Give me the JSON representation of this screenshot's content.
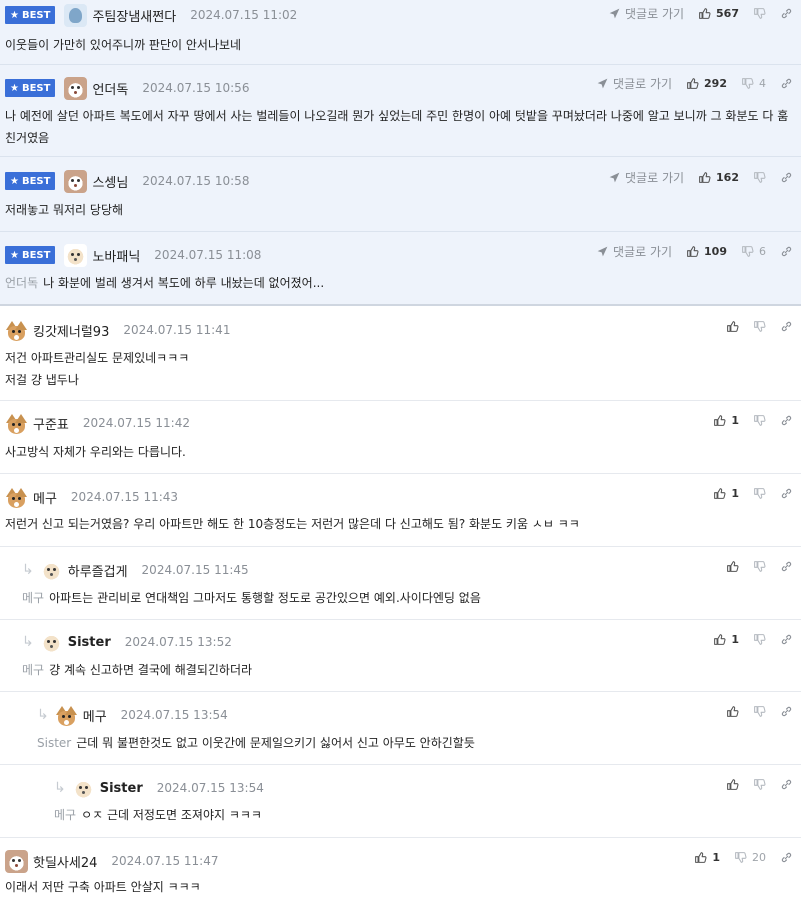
{
  "ui": {
    "best_label": "BEST",
    "reply_label": "댓글로 가기"
  },
  "comments": [
    {
      "nick": "주팀장냄새쩐다",
      "date": "2024.07.15 11:02",
      "text": "이웃들이 가만히 있어주니까 판단이 안서나보네",
      "likes": "567",
      "dislikes": ""
    },
    {
      "nick": "언더독",
      "date": "2024.07.15 10:56",
      "text": "나 예전에 살던 아파트 복도에서 자꾸 땅에서 사는 벌레들이 나오길래 뭔가 싶었는데 주민 한명이 아예 텃밭을 꾸며놨더라 나중에 알고 보니까 그 화분도 다 훔친거였음",
      "likes": "292",
      "dislikes": "4"
    },
    {
      "nick": "스셍님",
      "date": "2024.07.15 10:58",
      "text": "저래놓고 뭐저리 당당해",
      "likes": "162",
      "dislikes": ""
    },
    {
      "nick": "노바패닉",
      "date": "2024.07.15 11:08",
      "mention": "언더독",
      "text": "나 화분에 벌레 생겨서 복도에 하루 내놨는데 없어졌어...",
      "likes": "109",
      "dislikes": "6"
    },
    {
      "nick": "킹갓제너럴93",
      "date": "2024.07.15 11:41",
      "text": "저건 아파트관리실도 문제있네ㅋㅋㅋ",
      "text2": "저걸 걍 냅두나",
      "likes": "",
      "dislikes": ""
    },
    {
      "nick": "구준표",
      "date": "2024.07.15 11:42",
      "text": "사고방식 자체가 우리와는 다릅니다.",
      "likes": "1",
      "dislikes": ""
    },
    {
      "nick": "메구",
      "date": "2024.07.15 11:43",
      "text": "저런거 신고 되는거였음? 우리 아파트만 해도 한 10층정도는 저런거 많은데 다 신고해도 됨? 화분도 키움 ㅅㅂ ㅋㅋ",
      "likes": "1",
      "dislikes": ""
    },
    {
      "nick": "하루즐겁게",
      "date": "2024.07.15 11:45",
      "mention": "메구",
      "text": "아파트는 관리비로 연대책임 그마저도 통행할 정도로 공간있으면 예외.사이다엔딩 없음",
      "likes": "",
      "dislikes": ""
    },
    {
      "nick": "Sister",
      "date": "2024.07.15 13:52",
      "mention": "메구",
      "text": "걍 계속 신고하면 결국에 해결되긴하더라",
      "likes": "1",
      "dislikes": ""
    },
    {
      "nick": "메구",
      "date": "2024.07.15 13:54",
      "mention": "Sister",
      "text": "근데 뭐 불편한것도 없고 이웃간에 문제일으키기 싫어서 신고 아무도 안하긴할듯",
      "likes": "",
      "dislikes": ""
    },
    {
      "nick": "Sister",
      "date": "2024.07.15 13:54",
      "mention": "메구",
      "text": "ㅇㅈ 근데 저정도면 조져야지 ㅋㅋㅋ",
      "likes": "",
      "dislikes": ""
    },
    {
      "nick": "핫딜사세24",
      "date": "2024.07.15 11:47",
      "text": "이래서 저딴 구축 아파트 안살지 ㅋㅋㅋ",
      "likes": "1",
      "dislikes": "20"
    }
  ]
}
